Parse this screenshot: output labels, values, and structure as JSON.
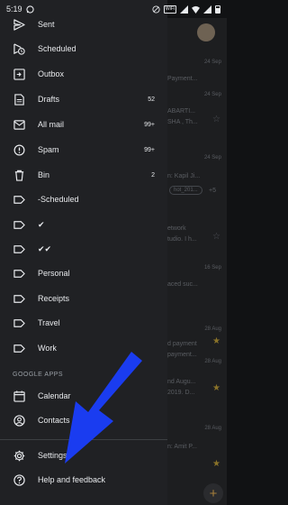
{
  "status_bar": {
    "time": "5:19",
    "wifi_badge": "WiFi"
  },
  "drawer": {
    "items": [
      {
        "label": "Sent",
        "count": ""
      },
      {
        "label": "Scheduled",
        "count": ""
      },
      {
        "label": "Outbox",
        "count": ""
      },
      {
        "label": "Drafts",
        "count": "52"
      },
      {
        "label": "All mail",
        "count": "99+"
      },
      {
        "label": "Spam",
        "count": "99+"
      },
      {
        "label": "Bin",
        "count": "2"
      },
      {
        "label": "-Scheduled",
        "count": ""
      },
      {
        "label": "✔",
        "count": ""
      },
      {
        "label": "✔✔",
        "count": ""
      },
      {
        "label": "Personal",
        "count": ""
      },
      {
        "label": "Receipts",
        "count": ""
      },
      {
        "label": "Travel",
        "count": ""
      },
      {
        "label": "Work",
        "count": ""
      }
    ],
    "google_apps_header": "GOOGLE APPS",
    "apps": [
      {
        "label": "Calendar"
      },
      {
        "label": "Contacts"
      }
    ],
    "footer": [
      {
        "label": "Settings"
      },
      {
        "label": "Help and feedback"
      }
    ]
  },
  "inbox_bg": {
    "dates": [
      "24 Sep",
      "24 Sep",
      "24 Sep",
      "16 Sep",
      "28 Aug",
      "28 Aug",
      "28 Aug"
    ],
    "snippets": [
      "Payment...",
      "ABARTI...",
      "SHA , Th...",
      "n: Kapil Ji...",
      "etwork",
      "tudio. I h...",
      "aced suc...",
      "d payment",
      "payment...",
      "nd  Augu...",
      "2019. D...",
      "n: Amit P..."
    ],
    "chips": [
      "hot_201...",
      "+5"
    ]
  },
  "colors": {
    "drawer_bg": "#202124",
    "arrow": "#1a3cf0",
    "star": "#8a7329"
  }
}
